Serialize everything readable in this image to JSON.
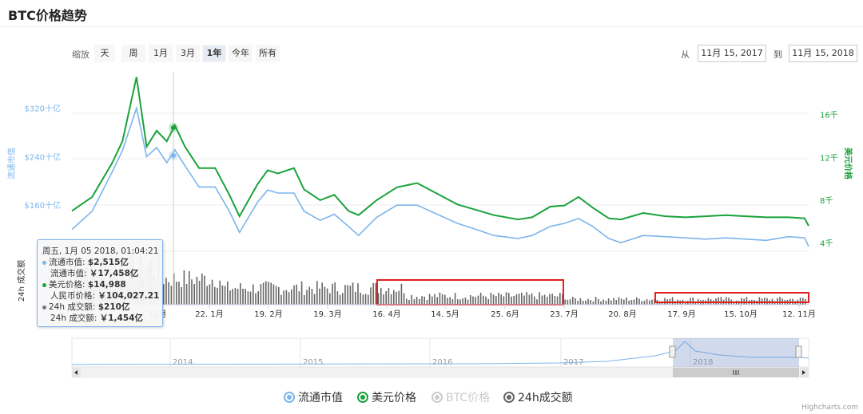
{
  "title": "BTC价格趋势",
  "zoom": {
    "label": "缩放",
    "buttons": [
      "天",
      "周",
      "1月",
      "3月",
      "1年",
      "今年",
      "所有"
    ],
    "active": "1年"
  },
  "range": {
    "from_label": "从",
    "from": "11月 15, 2017",
    "to_label": "到",
    "to": "11月 15, 2018"
  },
  "tooltip": {
    "date": "周五, 1月 05 2018, 01:04:21",
    "rows": [
      {
        "label": "流通市值: ",
        "value": "$2,515亿",
        "dot": "#7cb5ec"
      },
      {
        "label": "流通市值: ",
        "value": "￥17,458亿",
        "dot": ""
      },
      {
        "label": "美元价格: ",
        "value": "$14,988",
        "dot": "#1aa23b"
      },
      {
        "label": "人民币价格: ",
        "value": "￥104,027.21",
        "dot": ""
      },
      {
        "label": "24h 成交额: ",
        "value": "$210亿",
        "dot": "#777777"
      },
      {
        "label": "24h 成交额: ",
        "value": "￥1,454亿",
        "dot": ""
      }
    ]
  },
  "legend": [
    {
      "name": "流通市值",
      "color": "#7cb5ec",
      "hidden": false
    },
    {
      "name": "美元价格",
      "color": "#1aa23b",
      "hidden": false
    },
    {
      "name": "BTC价格",
      "color": "#cccccc",
      "hidden": true
    },
    {
      "name": "24h成交额",
      "color": "#666666",
      "hidden": false
    }
  ],
  "credits": "Highcharts.com",
  "colors": {
    "market_cap": "#7cb5ec",
    "usd_price": "#1aa23b",
    "volume": "#666666",
    "highlight": "#e02020",
    "navigator_mask": "#ccd6eb"
  },
  "chart_data": {
    "type": "line",
    "y_left": {
      "label": "流通市值",
      "ticks": [
        "$160十亿",
        "$240十亿",
        "$320十亿"
      ],
      "range": [
        80,
        380
      ],
      "unit": "十亿美元"
    },
    "y_right": {
      "label": "美元价格",
      "ticks": [
        "4千",
        "8千",
        "12千",
        "16千"
      ],
      "range": [
        3,
        20
      ],
      "unit": "千美元"
    },
    "y_volume": {
      "label": "24h 成交额"
    },
    "x_ticks": [
      "12月",
      "22. 1月",
      "19. 2月",
      "19. 3月",
      "16. 4月",
      "14. 5月",
      "25. 6月",
      "23. 7月",
      "20. 8月",
      "17. 9月",
      "15. 10月",
      "12. 11月"
    ],
    "x_range": [
      "2017-11-15",
      "2018-11-15"
    ],
    "series": [
      {
        "name": "流通市值",
        "x": [
          "2017-11-15",
          "2017-11-25",
          "2017-12-05",
          "2017-12-10",
          "2017-12-17",
          "2017-12-22",
          "2017-12-27",
          "2018-01-01",
          "2018-01-05",
          "2018-01-10",
          "2018-01-17",
          "2018-01-25",
          "2018-02-01",
          "2018-02-06",
          "2018-02-15",
          "2018-02-20",
          "2018-02-25",
          "2018-03-05",
          "2018-03-10",
          "2018-03-18",
          "2018-03-25",
          "2018-04-01",
          "2018-04-06",
          "2018-04-15",
          "2018-04-25",
          "2018-05-05",
          "2018-05-15",
          "2018-05-25",
          "2018-06-05",
          "2018-06-12",
          "2018-06-24",
          "2018-07-01",
          "2018-07-10",
          "2018-07-17",
          "2018-07-24",
          "2018-07-31",
          "2018-08-08",
          "2018-08-14",
          "2018-08-25",
          "2018-09-05",
          "2018-09-15",
          "2018-09-25",
          "2018-10-05",
          "2018-10-15",
          "2018-10-25",
          "2018-11-05",
          "2018-11-13",
          "2018-11-15"
        ],
        "values": [
          120,
          150,
          215,
          250,
          320,
          240,
          255,
          230,
          251.5,
          225,
          190,
          190,
          150,
          115,
          165,
          185,
          180,
          180,
          150,
          135,
          145,
          125,
          110,
          140,
          160,
          160,
          145,
          130,
          118,
          110,
          105,
          110,
          125,
          130,
          138,
          125,
          105,
          98,
          110,
          108,
          106,
          104,
          106,
          104,
          102,
          108,
          106,
          92
        ]
      },
      {
        "name": "美元价格",
        "x": [
          "2017-11-15",
          "2017-11-25",
          "2017-12-05",
          "2017-12-10",
          "2017-12-17",
          "2017-12-22",
          "2017-12-27",
          "2018-01-01",
          "2018-01-05",
          "2018-01-10",
          "2018-01-17",
          "2018-01-25",
          "2018-02-01",
          "2018-02-06",
          "2018-02-15",
          "2018-02-20",
          "2018-02-25",
          "2018-03-05",
          "2018-03-10",
          "2018-03-18",
          "2018-03-25",
          "2018-04-01",
          "2018-04-06",
          "2018-04-15",
          "2018-04-25",
          "2018-05-05",
          "2018-05-15",
          "2018-05-25",
          "2018-06-05",
          "2018-06-12",
          "2018-06-24",
          "2018-07-01",
          "2018-07-10",
          "2018-07-17",
          "2018-07-24",
          "2018-07-31",
          "2018-08-08",
          "2018-08-14",
          "2018-08-25",
          "2018-09-05",
          "2018-09-15",
          "2018-09-25",
          "2018-10-05",
          "2018-10-15",
          "2018-10-25",
          "2018-11-05",
          "2018-11-13",
          "2018-11-15"
        ],
        "values": [
          7.0,
          8.3,
          11.5,
          13.5,
          19.5,
          13.0,
          14.5,
          13.5,
          14.988,
          13.0,
          11.0,
          11.0,
          8.5,
          6.5,
          9.5,
          10.8,
          10.5,
          11.0,
          9.0,
          8.0,
          8.5,
          7.0,
          6.6,
          8.0,
          9.2,
          9.6,
          8.6,
          7.6,
          7.0,
          6.6,
          6.2,
          6.4,
          7.4,
          7.5,
          8.3,
          7.3,
          6.3,
          6.2,
          6.8,
          6.5,
          6.4,
          6.5,
          6.6,
          6.5,
          6.4,
          6.4,
          6.3,
          5.6
        ]
      },
      {
        "name": "24h成交额",
        "values_description": "daily volume bars"
      }
    ],
    "navigator": {
      "x_ticks": [
        "2014",
        "2015",
        "2016",
        "2017",
        "2018"
      ]
    }
  }
}
